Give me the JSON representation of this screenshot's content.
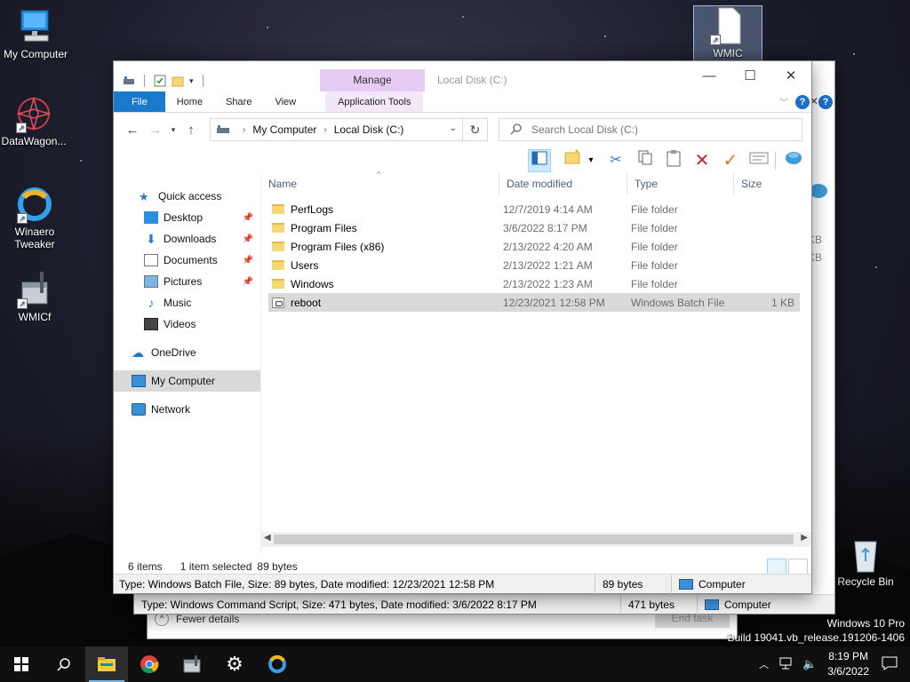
{
  "desktop": {
    "icons": [
      {
        "label": "My Computer"
      },
      {
        "label": "DataWagon..."
      },
      {
        "label": "Winaero Tweaker"
      },
      {
        "label": "WMICf"
      },
      {
        "label": "WMIC"
      },
      {
        "label": "Recycle Bin"
      }
    ],
    "watermark": {
      "line1": "Windows 10 Pro",
      "line2": "Build 19041.vb_release.191206-1406"
    }
  },
  "behind_dialog": {
    "fewer_details": "Fewer details",
    "end_task": "End task"
  },
  "behind_explorer": {
    "help": "?",
    "kb1": "KB",
    "kb2": "KB",
    "info_text": "Type: Windows Command Script, Size: 471 bytes, Date modified: 3/6/2022 8:17 PM",
    "info_size": "471 bytes",
    "info_location": "Computer"
  },
  "explorer": {
    "title": "Local Disk (C:)",
    "contextual_group": "Manage",
    "window_controls": {
      "minimize": "—",
      "maximize": "☐",
      "close": "✕"
    },
    "ribbon_tabs": {
      "file": "File",
      "home": "Home",
      "share": "Share",
      "view": "View",
      "app_tools": "Application Tools"
    },
    "help": "?",
    "breadcrumb": [
      "My Computer",
      "Local Disk (C:)"
    ],
    "search_placeholder": "Search Local Disk (C:)",
    "nav": {
      "quick_access": "Quick access",
      "desktop": "Desktop",
      "downloads": "Downloads",
      "documents": "Documents",
      "pictures": "Pictures",
      "music": "Music",
      "videos": "Videos",
      "onedrive": "OneDrive",
      "my_computer": "My Computer",
      "network": "Network"
    },
    "columns": {
      "name": "Name",
      "date": "Date modified",
      "type": "Type",
      "size": "Size"
    },
    "files": [
      {
        "name": "PerfLogs",
        "date": "12/7/2019 4:14 AM",
        "type": "File folder",
        "size": ""
      },
      {
        "name": "Program Files",
        "date": "3/6/2022 8:17 PM",
        "type": "File folder",
        "size": ""
      },
      {
        "name": "Program Files (x86)",
        "date": "2/13/2022 4:20 AM",
        "type": "File folder",
        "size": ""
      },
      {
        "name": "Users",
        "date": "2/13/2022 1:21 AM",
        "type": "File folder",
        "size": ""
      },
      {
        "name": "Windows",
        "date": "2/13/2022 1:23 AM",
        "type": "File folder",
        "size": ""
      },
      {
        "name": "reboot",
        "date": "12/23/2021 12:58 PM",
        "type": "Windows Batch File",
        "size": "1 KB"
      }
    ],
    "status": {
      "count": "6 items",
      "selected": "1 item selected",
      "bytes": "89 bytes"
    },
    "infobar": {
      "text": "Type: Windows Batch File, Size: 89 bytes, Date modified: 12/23/2021 12:58 PM",
      "size": "89 bytes",
      "location": "Computer"
    }
  },
  "taskbar": {
    "time": "8:19 PM",
    "date": "3/6/2022"
  }
}
